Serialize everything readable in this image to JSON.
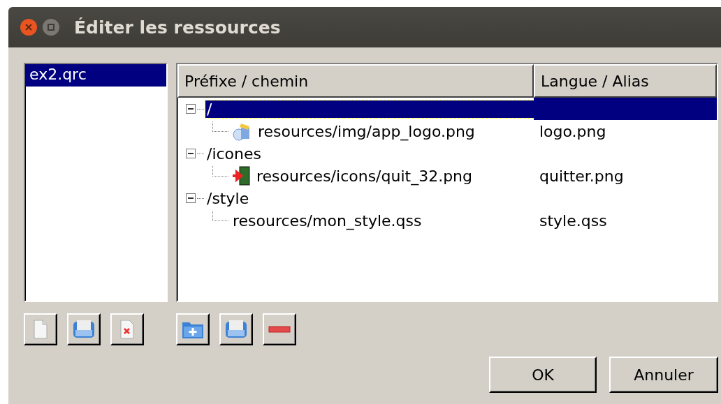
{
  "window": {
    "title": "Éditer les ressources"
  },
  "files": [
    {
      "label": "ex2.qrc",
      "selected": true
    }
  ],
  "file_buttons": [
    {
      "kind": "new"
    },
    {
      "kind": "save"
    },
    {
      "kind": "delete"
    }
  ],
  "tree": {
    "columns": [
      "Préfixe / chemin",
      "Langue / Alias"
    ],
    "rows": [
      {
        "label": "/",
        "selected": true,
        "expanded": true,
        "children": [
          {
            "label": "resources/img/app_logo.png",
            "alias": "logo.png",
            "kind": "image",
            "selected": false
          }
        ]
      },
      {
        "label": "/icones",
        "selected": false,
        "expanded": true,
        "children": [
          {
            "label": "resources/icons/quit_32.png",
            "alias": "quitter.png",
            "kind": "exit",
            "selected": false
          }
        ]
      },
      {
        "label": "/style",
        "selected": false,
        "expanded": true,
        "children": [
          {
            "label": "resources/mon_style.qss",
            "alias": "style.qss",
            "kind": "plain",
            "selected": false
          }
        ]
      }
    ]
  },
  "tree_buttons": [
    {
      "kind": "add-folder"
    },
    {
      "kind": "save"
    },
    {
      "kind": "remove"
    }
  ],
  "buttons": [
    "OK",
    "Annuler"
  ]
}
